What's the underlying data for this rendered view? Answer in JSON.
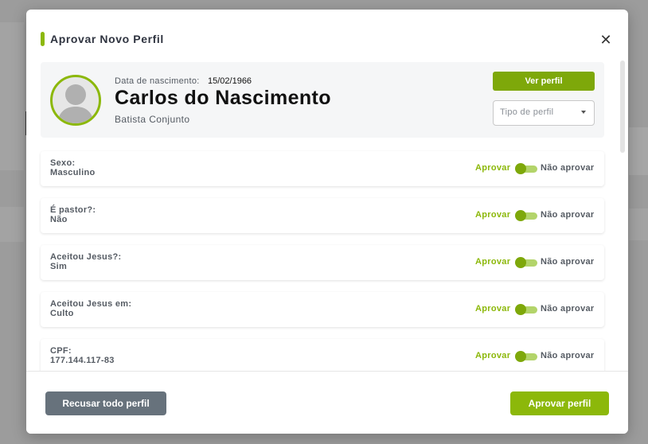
{
  "modal": {
    "title": "Aprovar Novo Perfil",
    "close_icon": "close-icon",
    "accent_color": "#8cb80a"
  },
  "profile": {
    "dob_label": "Data de nascimento:",
    "dob_value": "15/02/1966",
    "name": "Carlos do Nascimento",
    "church": "Batista Conjunto",
    "avatar_icon": "user-avatar-icon",
    "view_button": "Ver perfil",
    "profile_type_placeholder": "Tipo de perfil"
  },
  "fields": [
    {
      "label": "Sexo:",
      "value": "Masculino",
      "approve": "Aprovar",
      "reject": "Não aprovar"
    },
    {
      "label": "É pastor?:",
      "value": "Não",
      "approve": "Aprovar",
      "reject": "Não aprovar"
    },
    {
      "label": "Aceitou Jesus?:",
      "value": "Sim",
      "approve": "Aprovar",
      "reject": "Não aprovar"
    },
    {
      "label": "Aceitou Jesus em:",
      "value": "Culto",
      "approve": "Aprovar",
      "reject": "Não aprovar"
    },
    {
      "label": "CPF:",
      "value": "177.144.117-83",
      "approve": "Aprovar",
      "reject": "Não aprovar"
    }
  ],
  "footer": {
    "reject_all": "Recusar todo perfil",
    "approve_all": "Aprovar perfil"
  }
}
